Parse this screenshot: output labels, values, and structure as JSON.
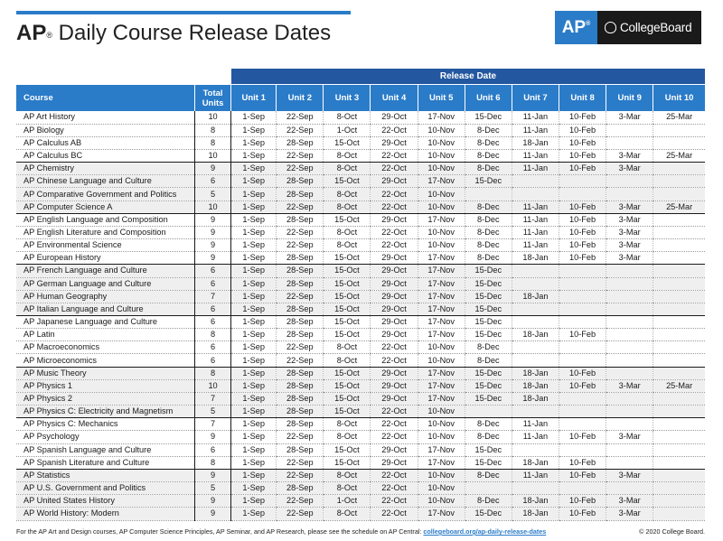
{
  "header": {
    "title_prefix": "AP",
    "title_sup": "®",
    "title_text": " Daily Course Release Dates",
    "brand_ap": "AP",
    "brand_sup": "®",
    "brand_cb": "CollegeBoard",
    "release_date_label": "Release Date"
  },
  "table": {
    "columns": [
      "Course",
      "Total Units",
      "Unit 1",
      "Unit 2",
      "Unit 3",
      "Unit 4",
      "Unit 5",
      "Unit 6",
      "Unit 7",
      "Unit 8",
      "Unit 9",
      "Unit 10"
    ],
    "rows": [
      [
        "AP Art History",
        "10",
        "1-Sep",
        "22-Sep",
        "8-Oct",
        "29-Oct",
        "17-Nov",
        "15-Dec",
        "11-Jan",
        "10-Feb",
        "3-Mar",
        "25-Mar"
      ],
      [
        "AP Biology",
        "8",
        "1-Sep",
        "22-Sep",
        "1-Oct",
        "22-Oct",
        "10-Nov",
        "8-Dec",
        "11-Jan",
        "10-Feb",
        "",
        ""
      ],
      [
        "AP Calculus AB",
        "8",
        "1-Sep",
        "28-Sep",
        "15-Oct",
        "29-Oct",
        "10-Nov",
        "8-Dec",
        "18-Jan",
        "10-Feb",
        "",
        ""
      ],
      [
        "AP Calculus BC",
        "10",
        "1-Sep",
        "22-Sep",
        "8-Oct",
        "22-Oct",
        "10-Nov",
        "8-Dec",
        "11-Jan",
        "10-Feb",
        "3-Mar",
        "25-Mar"
      ],
      [
        "AP Chemistry",
        "9",
        "1-Sep",
        "22-Sep",
        "8-Oct",
        "22-Oct",
        "10-Nov",
        "8-Dec",
        "11-Jan",
        "10-Feb",
        "3-Mar",
        ""
      ],
      [
        "AP Chinese Language and Culture",
        "6",
        "1-Sep",
        "28-Sep",
        "15-Oct",
        "29-Oct",
        "17-Nov",
        "15-Dec",
        "",
        "",
        "",
        ""
      ],
      [
        "AP Comparative Government and Politics",
        "5",
        "1-Sep",
        "28-Sep",
        "8-Oct",
        "22-Oct",
        "10-Nov",
        "",
        "",
        "",
        "",
        ""
      ],
      [
        "AP Computer Science A",
        "10",
        "1-Sep",
        "22-Sep",
        "8-Oct",
        "22-Oct",
        "10-Nov",
        "8-Dec",
        "11-Jan",
        "10-Feb",
        "3-Mar",
        "25-Mar"
      ],
      [
        "AP English Language and Composition",
        "9",
        "1-Sep",
        "28-Sep",
        "15-Oct",
        "29-Oct",
        "17-Nov",
        "8-Dec",
        "11-Jan",
        "10-Feb",
        "3-Mar",
        ""
      ],
      [
        "AP English Literature and Composition",
        "9",
        "1-Sep",
        "22-Sep",
        "8-Oct",
        "22-Oct",
        "10-Nov",
        "8-Dec",
        "11-Jan",
        "10-Feb",
        "3-Mar",
        ""
      ],
      [
        "AP Environmental Science",
        "9",
        "1-Sep",
        "22-Sep",
        "8-Oct",
        "22-Oct",
        "10-Nov",
        "8-Dec",
        "11-Jan",
        "10-Feb",
        "3-Mar",
        ""
      ],
      [
        "AP European History",
        "9",
        "1-Sep",
        "28-Sep",
        "15-Oct",
        "29-Oct",
        "17-Nov",
        "8-Dec",
        "18-Jan",
        "10-Feb",
        "3-Mar",
        ""
      ],
      [
        "AP French Language and Culture",
        "6",
        "1-Sep",
        "28-Sep",
        "15-Oct",
        "29-Oct",
        "17-Nov",
        "15-Dec",
        "",
        "",
        "",
        ""
      ],
      [
        "AP German Language and Culture",
        "6",
        "1-Sep",
        "28-Sep",
        "15-Oct",
        "29-Oct",
        "17-Nov",
        "15-Dec",
        "",
        "",
        "",
        ""
      ],
      [
        "AP Human Geography",
        "7",
        "1-Sep",
        "22-Sep",
        "15-Oct",
        "29-Oct",
        "17-Nov",
        "15-Dec",
        "18-Jan",
        "",
        "",
        ""
      ],
      [
        "AP Italian Language and Culture",
        "6",
        "1-Sep",
        "28-Sep",
        "15-Oct",
        "29-Oct",
        "17-Nov",
        "15-Dec",
        "",
        "",
        "",
        ""
      ],
      [
        "AP Japanese Language and Culture",
        "6",
        "1-Sep",
        "28-Sep",
        "15-Oct",
        "29-Oct",
        "17-Nov",
        "15-Dec",
        "",
        "",
        "",
        ""
      ],
      [
        "AP Latin",
        "8",
        "1-Sep",
        "28-Sep",
        "15-Oct",
        "29-Oct",
        "17-Nov",
        "15-Dec",
        "18-Jan",
        "10-Feb",
        "",
        ""
      ],
      [
        "AP Macroeconomics",
        "6",
        "1-Sep",
        "22-Sep",
        "8-Oct",
        "22-Oct",
        "10-Nov",
        "8-Dec",
        "",
        "",
        "",
        ""
      ],
      [
        "AP Microeconomics",
        "6",
        "1-Sep",
        "22-Sep",
        "8-Oct",
        "22-Oct",
        "10-Nov",
        "8-Dec",
        "",
        "",
        "",
        ""
      ],
      [
        "AP Music Theory",
        "8",
        "1-Sep",
        "28-Sep",
        "15-Oct",
        "29-Oct",
        "17-Nov",
        "15-Dec",
        "18-Jan",
        "10-Feb",
        "",
        ""
      ],
      [
        "AP Physics 1",
        "10",
        "1-Sep",
        "28-Sep",
        "15-Oct",
        "29-Oct",
        "17-Nov",
        "15-Dec",
        "18-Jan",
        "10-Feb",
        "3-Mar",
        "25-Mar"
      ],
      [
        "AP Physics 2",
        "7",
        "1-Sep",
        "28-Sep",
        "15-Oct",
        "29-Oct",
        "17-Nov",
        "15-Dec",
        "18-Jan",
        "",
        "",
        ""
      ],
      [
        "AP Physics C: Electricity and Magnetism",
        "5",
        "1-Sep",
        "28-Sep",
        "15-Oct",
        "22-Oct",
        "10-Nov",
        "",
        "",
        "",
        "",
        ""
      ],
      [
        "AP Physics C: Mechanics",
        "7",
        "1-Sep",
        "28-Sep",
        "8-Oct",
        "22-Oct",
        "10-Nov",
        "8-Dec",
        "11-Jan",
        "",
        "",
        ""
      ],
      [
        "AP Psychology",
        "9",
        "1-Sep",
        "22-Sep",
        "8-Oct",
        "22-Oct",
        "10-Nov",
        "8-Dec",
        "11-Jan",
        "10-Feb",
        "3-Mar",
        ""
      ],
      [
        "AP Spanish Language and Culture",
        "6",
        "1-Sep",
        "28-Sep",
        "15-Oct",
        "29-Oct",
        "17-Nov",
        "15-Dec",
        "",
        "",
        "",
        ""
      ],
      [
        "AP Spanish Literature and Culture",
        "8",
        "1-Sep",
        "22-Sep",
        "15-Oct",
        "29-Oct",
        "17-Nov",
        "15-Dec",
        "18-Jan",
        "10-Feb",
        "",
        ""
      ],
      [
        "AP Statistics",
        "9",
        "1-Sep",
        "22-Sep",
        "8-Oct",
        "22-Oct",
        "10-Nov",
        "8-Dec",
        "11-Jan",
        "10-Feb",
        "3-Mar",
        ""
      ],
      [
        "AP U.S. Government and Politics",
        "5",
        "1-Sep",
        "28-Sep",
        "8-Oct",
        "22-Oct",
        "10-Nov",
        "",
        "",
        "",
        "",
        ""
      ],
      [
        "AP United States History",
        "9",
        "1-Sep",
        "22-Sep",
        "1-Oct",
        "22-Oct",
        "10-Nov",
        "8-Dec",
        "18-Jan",
        "10-Feb",
        "3-Mar",
        ""
      ],
      [
        "AP World History: Modern",
        "9",
        "1-Sep",
        "22-Sep",
        "8-Oct",
        "22-Oct",
        "17-Nov",
        "15-Dec",
        "18-Jan",
        "10-Feb",
        "3-Mar",
        ""
      ]
    ],
    "shaded_rows": [
      4,
      5,
      6,
      7,
      12,
      13,
      14,
      15,
      20,
      21,
      22,
      23,
      28,
      29,
      30,
      31
    ],
    "group_end_rows": [
      3,
      7,
      11,
      15,
      19,
      23,
      27
    ]
  },
  "footer": {
    "note": "For the AP Art and Design courses, AP Computer Science Principles, AP Seminar, and AP Research, please see the schedule on AP Central: ",
    "link": "collegeboard.org/ap-daily-release-dates",
    "copyright": "© 2020 College Board."
  }
}
